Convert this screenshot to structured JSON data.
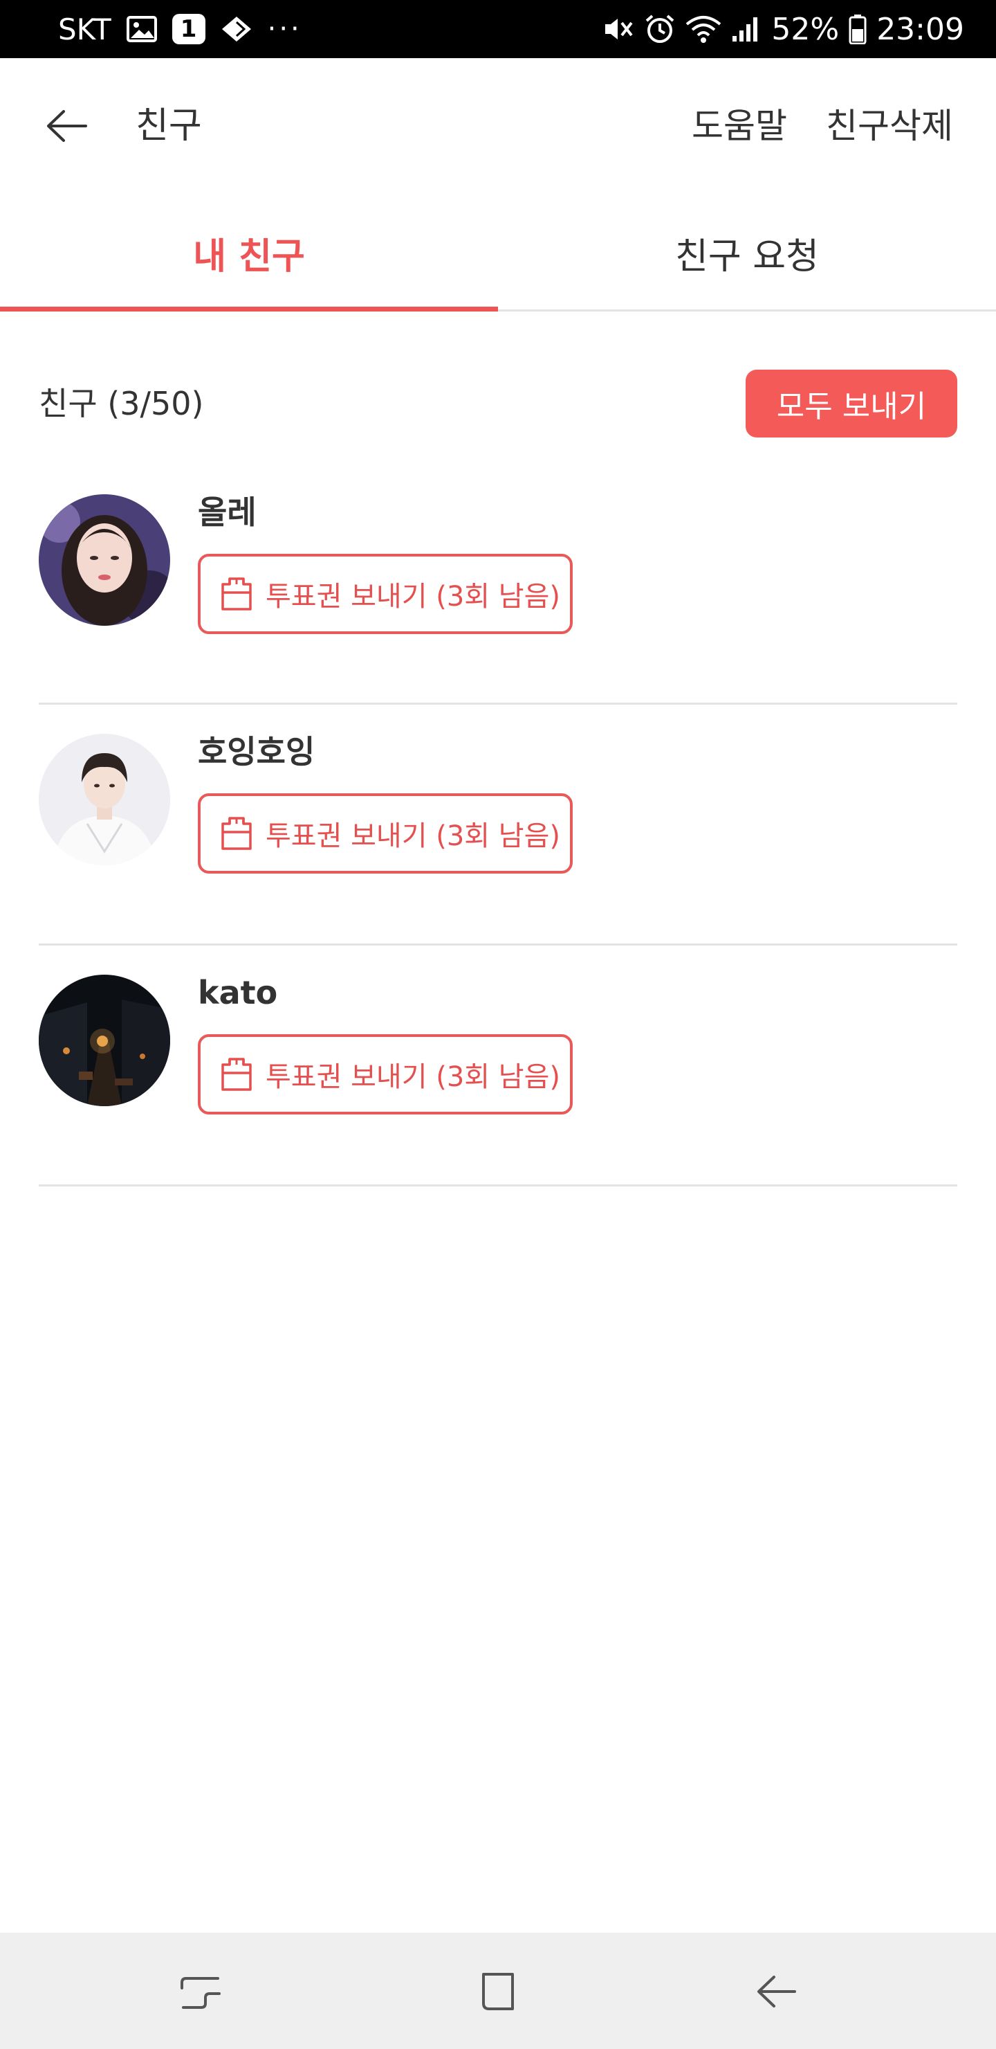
{
  "status_bar": {
    "carrier": "SKT",
    "notification_count": "1",
    "more": "···",
    "battery": "52%",
    "time": "23:09"
  },
  "header": {
    "title": "친구",
    "help_label": "도움말",
    "delete_label": "친구삭제"
  },
  "tabs": [
    {
      "label": "내 친구",
      "active": true
    },
    {
      "label": "친구 요청",
      "active": false
    }
  ],
  "friends_section": {
    "count_label": "친구 (3/50)",
    "send_all_label": "모두 보내기"
  },
  "friends": [
    {
      "name": "올레",
      "vote_label": "투표권 보내기 (3회 남음)",
      "avatar": "portrait-woman-dark-hair"
    },
    {
      "name": "호잉호잉",
      "vote_label": "투표권 보내기 (3회 남음)",
      "avatar": "portrait-man-white-shirt"
    },
    {
      "name": "kato",
      "vote_label": "투표권 보내기 (3회 남음)",
      "avatar": "night-street-scene"
    }
  ],
  "colors": {
    "accent": "#ee5454",
    "button_fill": "#f45b58",
    "divider": "#e3e3e3",
    "nav_bg": "#efefef"
  },
  "nav_bar": {
    "icons": [
      "recent-apps-icon",
      "home-icon",
      "back-icon"
    ]
  }
}
